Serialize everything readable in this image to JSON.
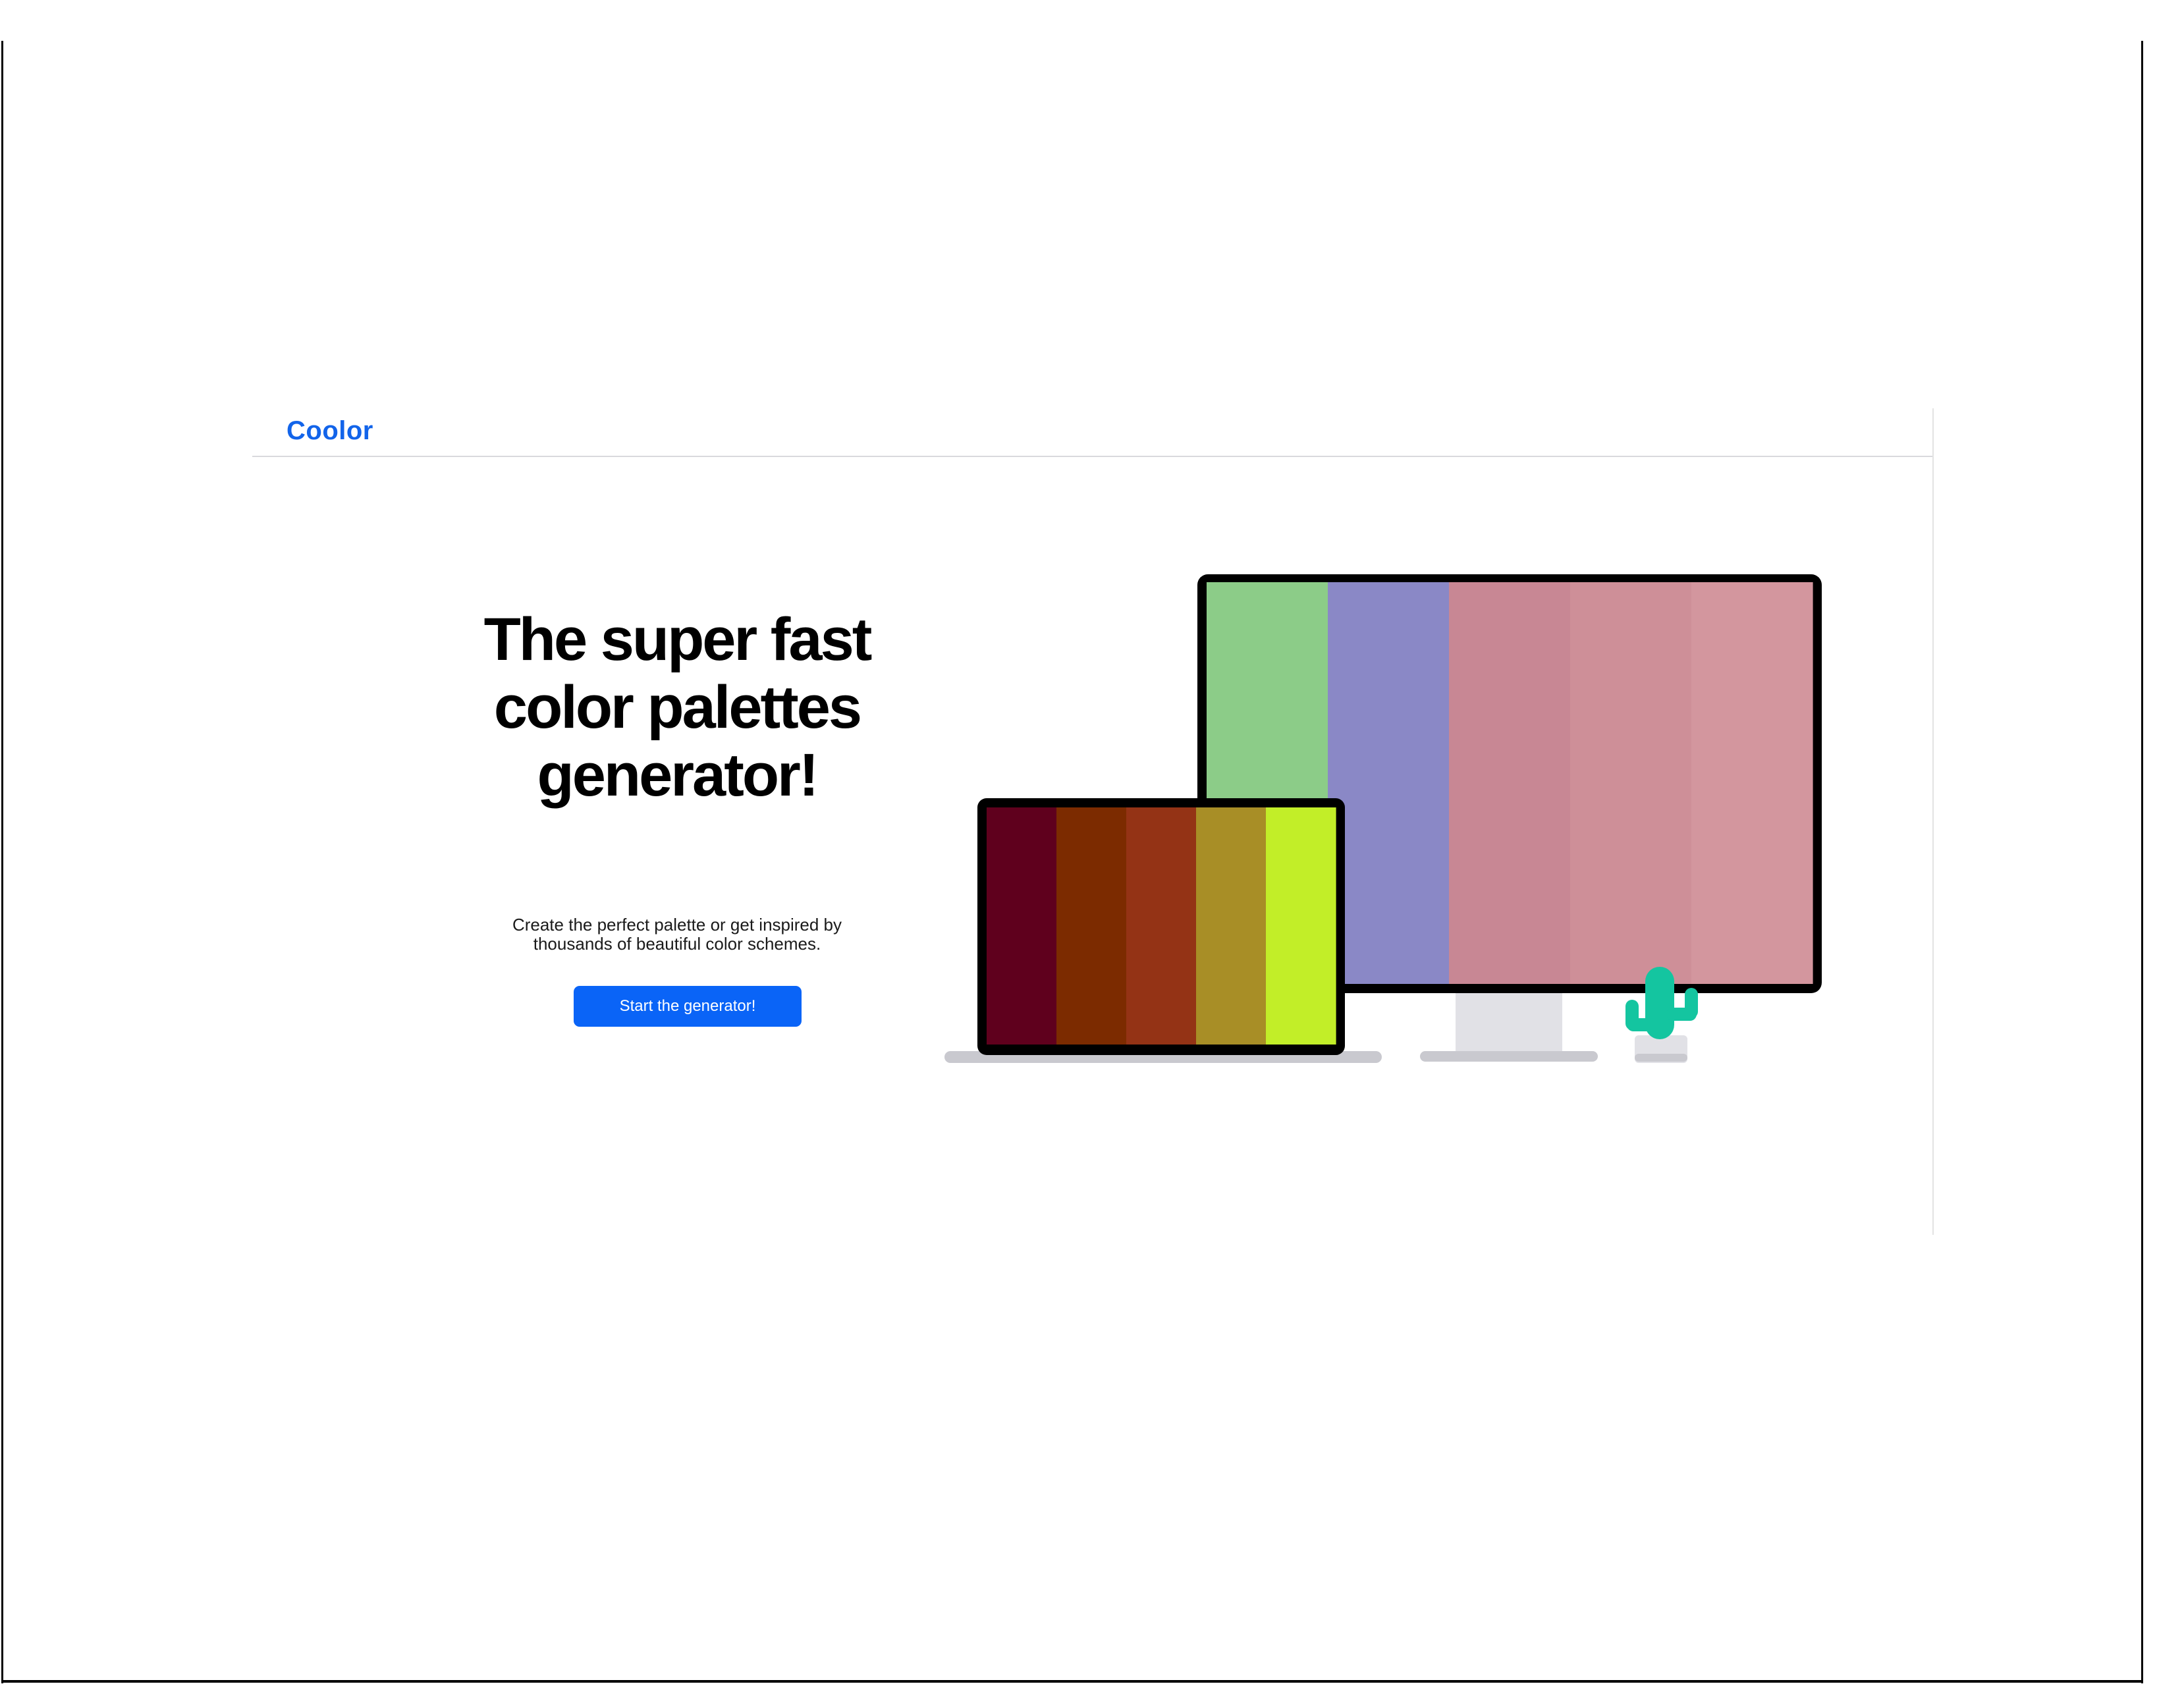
{
  "app": {
    "logo": "Coolor"
  },
  "hero": {
    "title": "The super fast color palettes generator!",
    "subtitle": "Create the perfect palette or get inspired by thousands of beautiful color schemes.",
    "cta_label": "Start the generator!"
  },
  "illustration": {
    "monitor_palette": [
      "#8ccc88",
      "#8a88c6",
      "#c88794",
      "#ce8f98",
      "#d3969e"
    ],
    "laptop_palette": [
      "#5f001d",
      "#7c2b00",
      "#943315",
      "#a88e26",
      "#c2ee28"
    ],
    "cactus_color": "#14c5a0",
    "device_frame_color": "#000000",
    "stand_color": "#e1e1e6",
    "base_color": "#c9c9cf"
  },
  "colors": {
    "brand": "#1264ea",
    "button": "#0a64f7"
  }
}
